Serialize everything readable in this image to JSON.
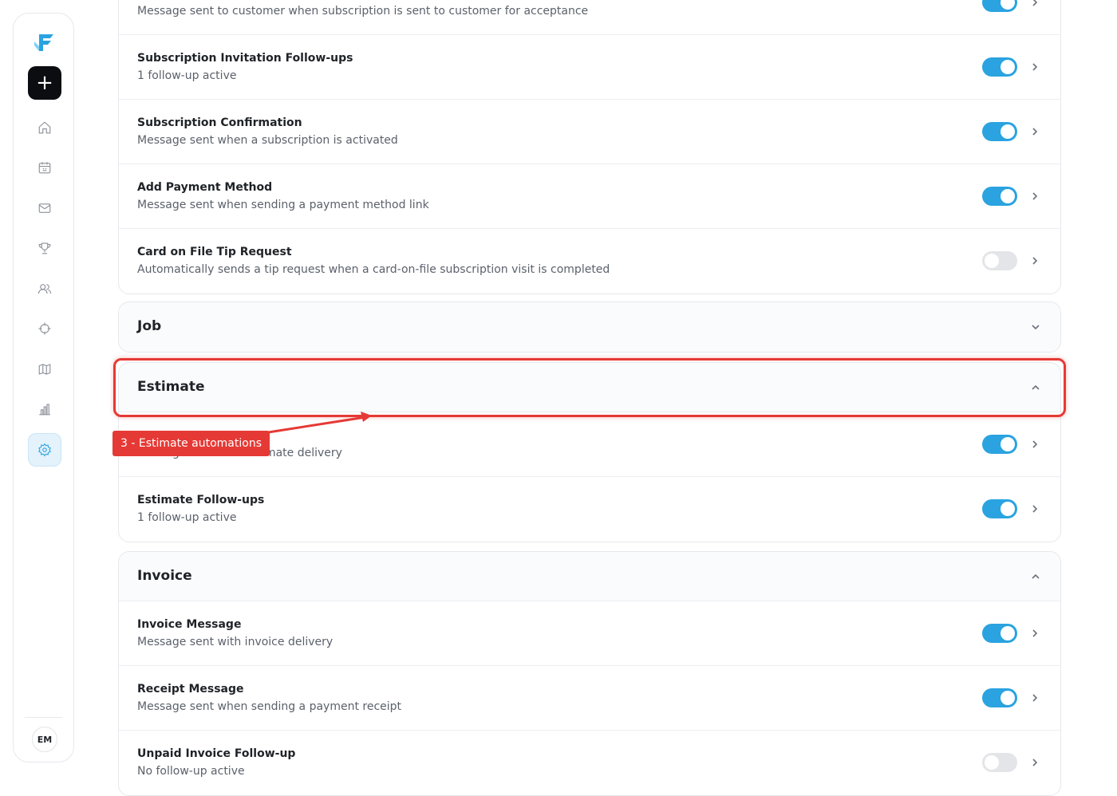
{
  "sidebar": {
    "add_label": "+",
    "avatar_initials": "EM",
    "items": [
      {
        "icon": "home-icon"
      },
      {
        "icon": "calendar-icon"
      },
      {
        "icon": "mail-icon"
      },
      {
        "icon": "trophy-icon"
      },
      {
        "icon": "users-icon"
      },
      {
        "icon": "target-icon"
      },
      {
        "icon": "map-icon"
      },
      {
        "icon": "bar-chart-icon"
      },
      {
        "icon": "gear-icon",
        "active": true
      }
    ],
    "accent_color": "#2aa3e0"
  },
  "subscription": {
    "rows": [
      {
        "title": "",
        "desc": "Message sent to customer when subscription is sent to customer for acceptance",
        "enabled": true
      },
      {
        "title": "Subscription Invitation Follow-ups",
        "desc": "1 follow-up active",
        "enabled": true
      },
      {
        "title": "Subscription Confirmation",
        "desc": "Message sent when a subscription is activated",
        "enabled": true
      },
      {
        "title": "Add Payment Method",
        "desc": "Message sent when sending a payment method link",
        "enabled": true
      },
      {
        "title": "Card on File Tip Request",
        "desc": "Automatically sends a tip request when a card-on-file subscription visit is completed",
        "enabled": false
      }
    ]
  },
  "job": {
    "title": "Job",
    "expanded": false
  },
  "estimate": {
    "title": "Estimate",
    "expanded": true,
    "rows": [
      {
        "title": "",
        "desc": "Message sent with estimate delivery",
        "enabled": true
      },
      {
        "title": "Estimate Follow-ups",
        "desc": "1 follow-up active",
        "enabled": true
      }
    ]
  },
  "invoice": {
    "title": "Invoice",
    "expanded": true,
    "rows": [
      {
        "title": "Invoice Message",
        "desc": "Message sent with invoice delivery",
        "enabled": true
      },
      {
        "title": "Receipt Message",
        "desc": "Message sent when sending a payment receipt",
        "enabled": true
      },
      {
        "title": "Unpaid Invoice Follow-up",
        "desc": "No follow-up active",
        "enabled": false
      }
    ]
  },
  "annotation": {
    "label": "3 - Estimate automations",
    "color": "#e53935"
  }
}
